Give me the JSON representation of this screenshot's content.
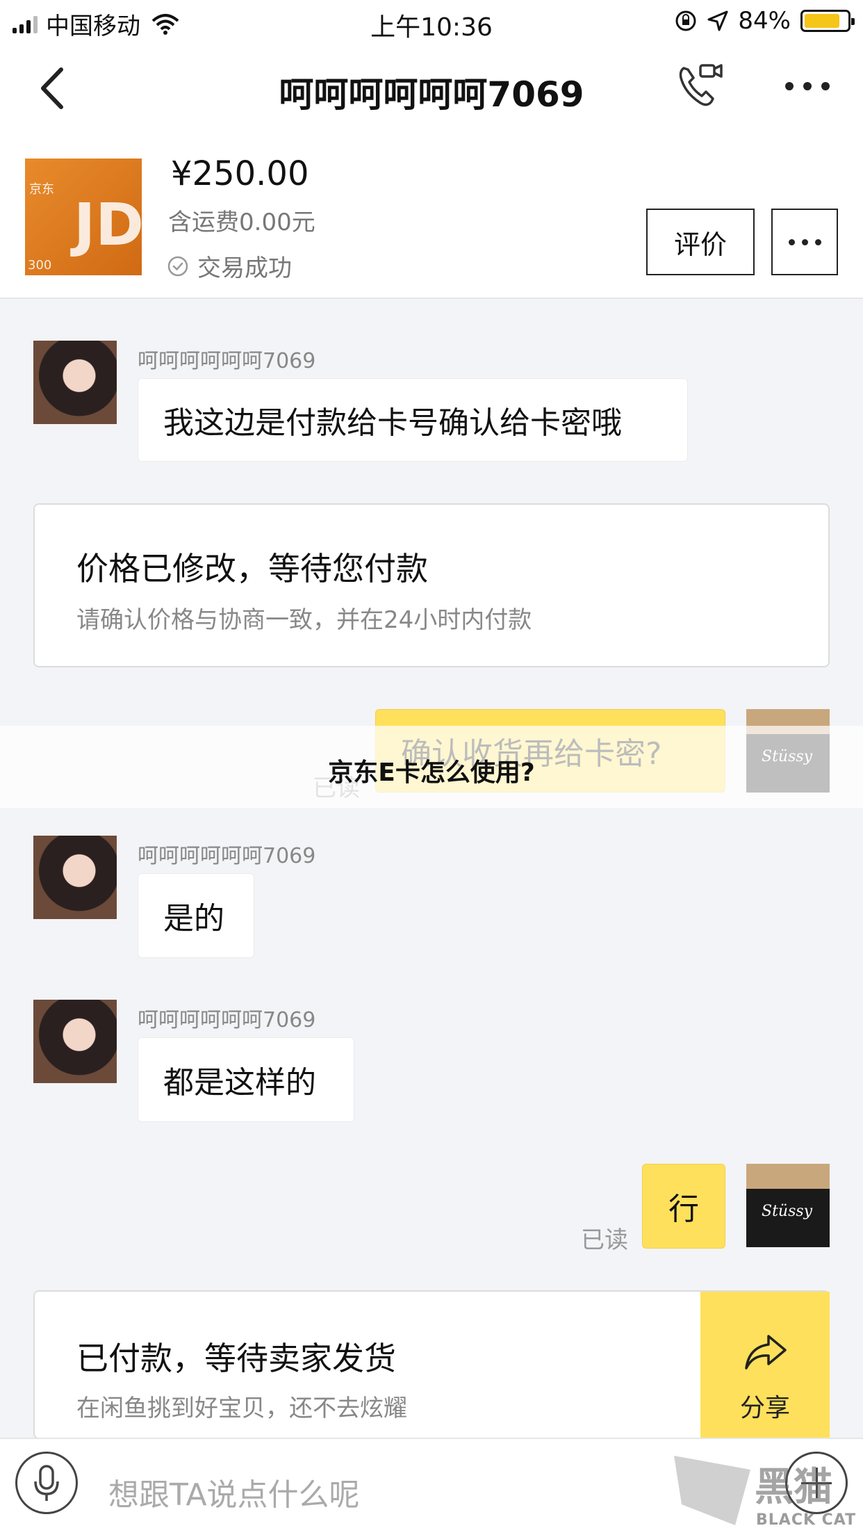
{
  "status_bar": {
    "carrier": "中国移动",
    "time": "上午10:36",
    "battery_text": "84%",
    "battery_level": 0.84
  },
  "nav": {
    "title": "呵呵呵呵呵呵7069"
  },
  "product": {
    "thumb_brand": "京东",
    "thumb_logo": "JD",
    "thumb_value": "300",
    "price": "¥250.00",
    "shipping": "含运费0.00元",
    "status": "交易成功",
    "review_button": "评价"
  },
  "chat": {
    "msg1": {
      "sender": "呵呵呵呵呵呵7069",
      "text": "我这边是付款给卡号确认给卡密哦"
    },
    "card1": {
      "title": "价格已修改，等待您付款",
      "subtitle": "请确认价格与协商一致，并在24小时内付款"
    },
    "msg2": {
      "text": "确认收货再给卡密?",
      "read": "已读"
    },
    "msg3": {
      "sender": "呵呵呵呵呵呵7069",
      "text": "是的"
    },
    "msg4": {
      "sender": "呵呵呵呵呵呵7069",
      "text": "都是这样的"
    },
    "msg5": {
      "text": "行",
      "read": "已读"
    },
    "card2": {
      "title": "已付款，等待卖家发货",
      "subtitle": "在闲鱼挑到好宝贝，还不去炫耀",
      "share_label": "分享"
    }
  },
  "overlay": {
    "text": "京东E卡怎么使用?"
  },
  "input": {
    "placeholder": "想跟TA说点什么呢"
  },
  "watermark": {
    "cn": "黑猫",
    "en": "BLACK CAT"
  },
  "colors": {
    "accent_yellow": "#ffe05c",
    "battery_yellow": "#f5c518",
    "background": "#f3f4f7"
  },
  "icons": [
    "back-icon",
    "video-call-icon",
    "more-icon",
    "check-circle-icon",
    "share-icon",
    "microphone-icon",
    "plus-icon",
    "wifi-icon",
    "location-icon",
    "rotation-lock-icon"
  ]
}
